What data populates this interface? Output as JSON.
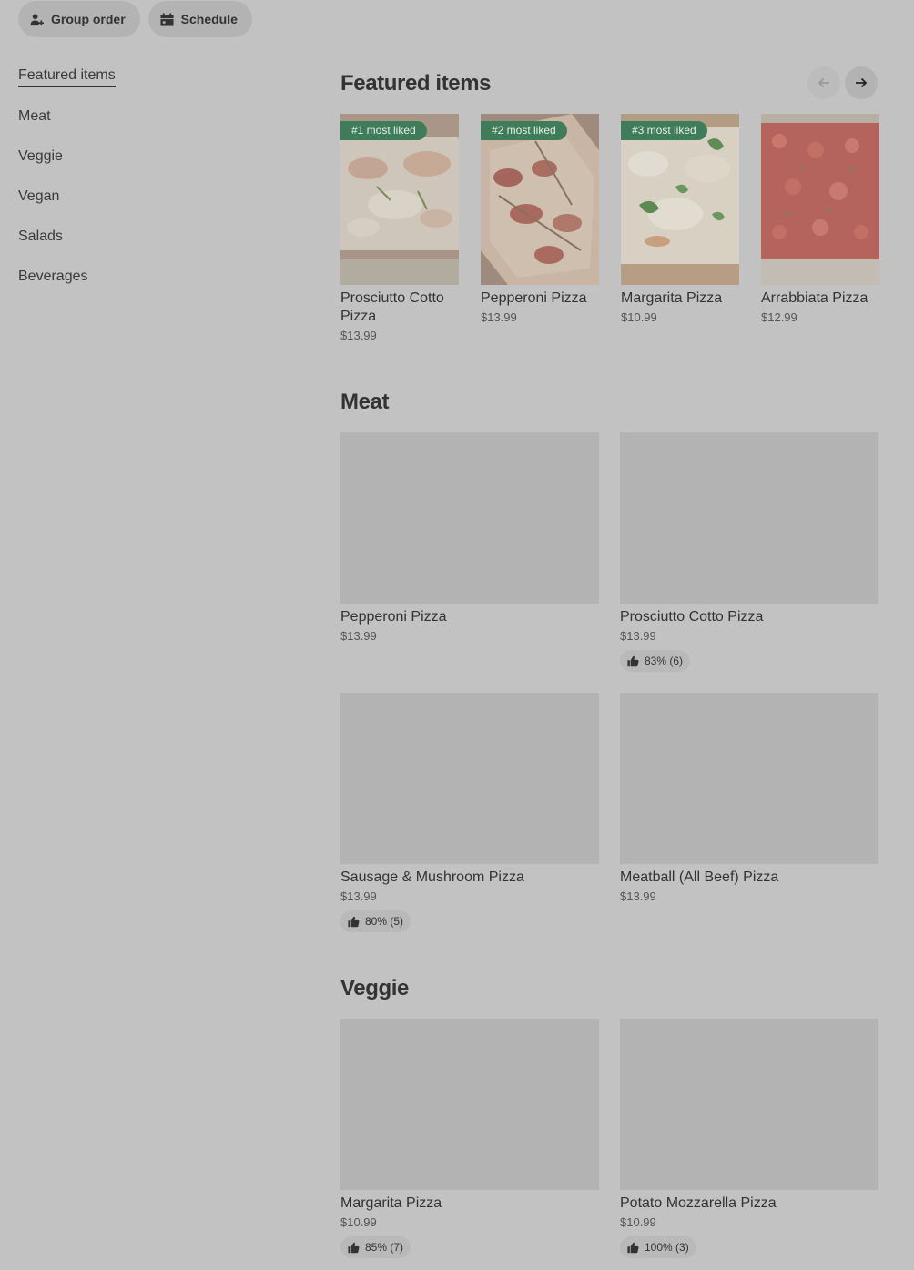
{
  "top_actions": {
    "group_order_label": "Group order",
    "schedule_label": "Schedule"
  },
  "sidebar": {
    "items": [
      {
        "label": "Featured items",
        "active": true
      },
      {
        "label": "Meat"
      },
      {
        "label": "Veggie"
      },
      {
        "label": "Vegan"
      },
      {
        "label": "Salads"
      },
      {
        "label": "Beverages"
      }
    ]
  },
  "featured": {
    "title": "Featured items",
    "items": [
      {
        "badge": "#1 most liked",
        "name": "Prosciutto Cotto Pizza",
        "price": "$13.99"
      },
      {
        "badge": "#2 most liked",
        "name": "Pepperoni Pizza",
        "price": "$13.99"
      },
      {
        "badge": "#3 most liked",
        "name": "Margarita Pizza",
        "price": "$10.99"
      },
      {
        "name": "Arrabbiata Pizza",
        "price": "$12.99"
      }
    ]
  },
  "meat": {
    "title": "Meat",
    "items": [
      {
        "name": "Pepperoni Pizza",
        "price": "$13.99"
      },
      {
        "name": "Prosciutto Cotto Pizza",
        "price": "$13.99",
        "rating": "83% (6)"
      },
      {
        "name": "Sausage & Mushroom Pizza",
        "price": "$13.99",
        "rating": "80% (5)"
      },
      {
        "name": "Meatball (All Beef) Pizza",
        "price": "$13.99"
      }
    ]
  },
  "veggie": {
    "title": "Veggie",
    "items": [
      {
        "name": "Margarita Pizza",
        "price": "$10.99",
        "rating": "85% (7)"
      },
      {
        "name": "Potato Mozzarella Pizza",
        "price": "$10.99",
        "rating": "100% (3)"
      }
    ]
  },
  "colors": {
    "background": "#c2c2c2",
    "badge": "#3f7d5a",
    "placeholder": "#b3b3b3"
  }
}
